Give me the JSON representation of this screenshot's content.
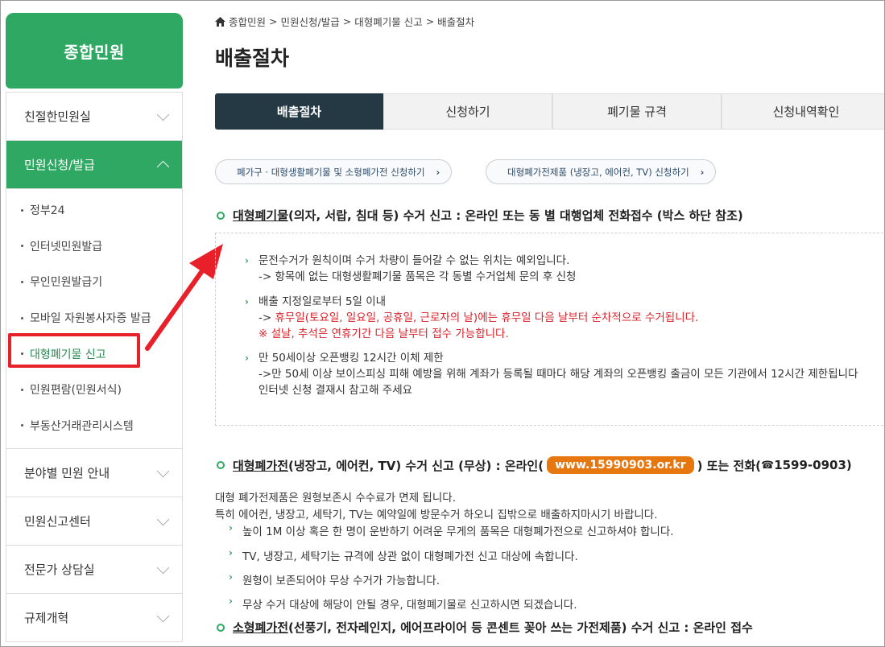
{
  "sidebar": {
    "title": "종합민원",
    "menu": [
      {
        "label": "친절한민원실"
      },
      {
        "label": "민원신청/발급"
      },
      {
        "label": "분야별 민원 안내"
      },
      {
        "label": "민원신고센터"
      },
      {
        "label": "전문가 상담실"
      },
      {
        "label": "규제개혁"
      }
    ],
    "sub": [
      {
        "label": "정부24"
      },
      {
        "label": "인터넷민원발급"
      },
      {
        "label": "무인민원발급기"
      },
      {
        "label": "모바일 자원봉사자증 발급"
      },
      {
        "label": "대형폐기물 신고"
      },
      {
        "label": "민원편람(민원서식)"
      },
      {
        "label": "부동산거래관리시스템"
      }
    ]
  },
  "breadcrumb": {
    "items": [
      "종합민원",
      "민원신청/발급",
      "대형폐기물 신고",
      "배출절차"
    ],
    "sep": ">"
  },
  "page": {
    "title": "배출절차"
  },
  "tabs": [
    {
      "label": "배출절차"
    },
    {
      "label": "신청하기"
    },
    {
      "label": "폐기물 규격"
    },
    {
      "label": "신청내역확인"
    }
  ],
  "pills": [
    {
      "label": "폐가구 · 대형생활폐기물 및 소형폐가전 신청하기"
    },
    {
      "label": "대형폐가전제품 (냉장고, 에어컨, TV) 신청하기"
    }
  ],
  "section1": {
    "title_u": "대형폐기물",
    "title_rest": " (의자, 서랍, 침대 등) 수거 신고 : 온라인 또는 동 별 대행업체 전화접수 (박스 하단 참조)",
    "b1_l1": "문전수거가 원칙이며 수거 차량이 들어갈 수 없는 위치는 예외입니다.",
    "b1_l2": "-> 항목에 없는 대형생활폐기물 품목은 각 동별 수거업체 문의 후 신청",
    "b2_l1": "배출 지정일로부터 5일 이내",
    "b2_l2_prefix": "-> ",
    "b2_l2_red": "휴무일(토요일, 일요일, 공휴일, 근로자의 날)에는 휴무일 다음 날부터 순차적으로 수거됩니다.",
    "b2_l3": "※ 설날, 추석은 연휴기간 다음 날부터 접수 가능합니다.",
    "b3_l1": "만 50세이상 오픈뱅킹 12시간 이체 제한",
    "b3_l2": "->만 50세 이상 보이스피싱 피해 예방을 위해 계좌가 등록될 때마다 해당 계좌의 오픈뱅킹 출금이 모든 기관에서 12시간 제한됩니다",
    "b3_l3": "인터넷 신청 결재시 참고해 주세요"
  },
  "section2": {
    "title_u": "대형폐가전",
    "title_mid": " (냉장고, 에어컨, TV) 수거 신고 (무상) : 온라인(",
    "website": "www.15990903.or.kr",
    "title_end": ") 또는 전화(",
    "phone_icon": "☎",
    "phone": "1599-0903",
    "title_close": ")",
    "p1": "대형 폐가전제품은 원형보존시 수수료가 면제 됩니다.",
    "p2": "특히 에어컨, 냉장고, 세탁기, TV는 예약일에 방문수거 하오니 집밖으로 배출하지마시기 바랍니다.",
    "bullets": [
      "높이 1M 이상 혹은 한 명이 운반하기 어려운 무게의 품목은 대형폐가전으로 신고하셔야 합니다.",
      "TV, 냉장고, 세탁기는 규격에 상관 없이 대형폐가전 신고 대상에 속합니다.",
      "원형이 보존되어야 무상 수거가 가능합니다.",
      "무상 수거 대상에 해당이 안될 경우, 대형폐기물로 신고하시면 되겠습니다."
    ]
  },
  "section3": {
    "title_u": "소형폐가전",
    "title_rest": " (선풍기, 전자레인지, 에어프라이어 등 콘센트 꽂아 쓰는 가전제품)  수거 신고 : 온라인 접수"
  },
  "colors": {
    "green": "#2ea862",
    "tab_dark": "#243943",
    "orange": "#e6770f",
    "annotation_red": "#e8202a"
  },
  "icons": [
    "home-icon",
    "chevron-down-icon",
    "chevron-up-icon",
    "phone-icon",
    "annotation-arrow"
  ]
}
